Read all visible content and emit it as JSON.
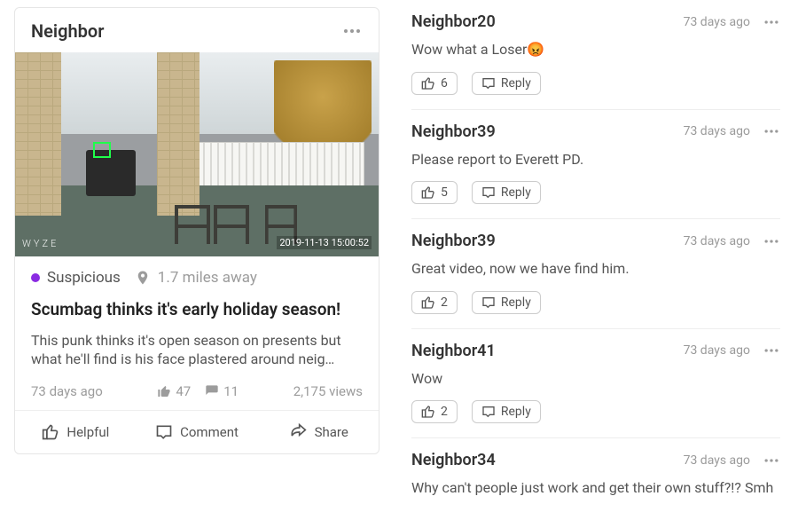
{
  "post": {
    "author": "Neighbor",
    "watermark_left": "WYZE",
    "watermark_right": "2019-11-13  15:00:52",
    "category_label": "Suspicious",
    "category_color": "#8a2be2",
    "distance": "1.7 miles away",
    "title": "Scumbag thinks it's early holiday season!",
    "description": "This punk thinks it's open season on presents but what he'll find is his face plastered around neig…",
    "age": "73 days ago",
    "likes": "47",
    "comments_count": "11",
    "views": "2,175 views"
  },
  "actions": {
    "helpful": "Helpful",
    "comment": "Comment",
    "share": "Share",
    "reply": "Reply"
  },
  "comments": [
    {
      "author": "Neighbor20",
      "age": "73 days ago",
      "body": "Wow what a Loser😡",
      "likes": "6"
    },
    {
      "author": "Neighbor39",
      "age": "73 days ago",
      "body": "Please report to Everett PD.",
      "likes": "5"
    },
    {
      "author": "Neighbor39",
      "age": "73 days ago",
      "body": "Great video, now we have find him.",
      "likes": "2"
    },
    {
      "author": "Neighbor41",
      "age": "73 days ago",
      "body": "Wow",
      "likes": "2"
    },
    {
      "author": "Neighbor34",
      "age": "73 days ago",
      "body": "Why can't people just work and get their own stuff?!? Smh",
      "likes": ""
    }
  ]
}
